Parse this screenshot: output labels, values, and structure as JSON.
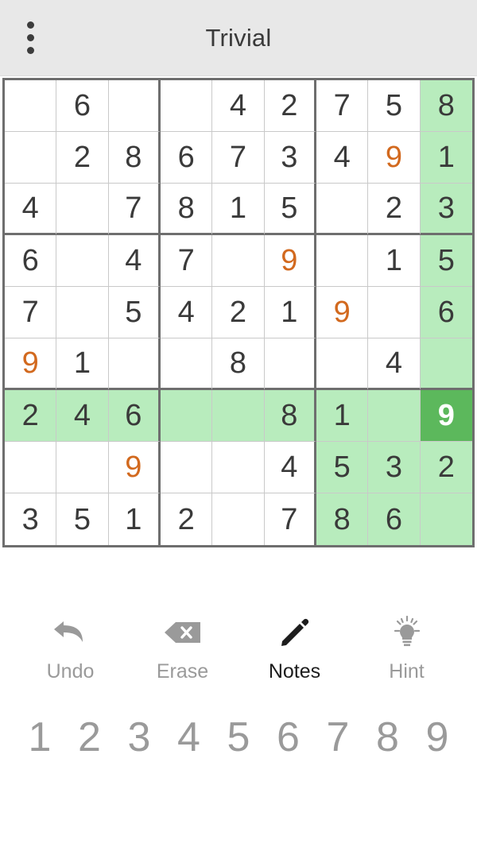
{
  "header": {
    "title": "Trivial",
    "menu_icon": "overflow-menu-icon"
  },
  "board": {
    "selected": {
      "row": 6,
      "col": 8
    },
    "colors": {
      "highlight": "#b8ecbd",
      "selected": "#5cb85c",
      "given_text": "#3a3a3a",
      "user_text": "#d2691e",
      "selected_text": "#ffffff",
      "grid_line": "#c9c9c9",
      "box_line": "#6e6e6e"
    },
    "rows": [
      [
        {
          "v": "",
          "t": "given",
          "h": false
        },
        {
          "v": "6",
          "t": "given",
          "h": false
        },
        {
          "v": "",
          "t": "given",
          "h": false
        },
        {
          "v": "",
          "t": "given",
          "h": false
        },
        {
          "v": "4",
          "t": "given",
          "h": false
        },
        {
          "v": "2",
          "t": "given",
          "h": false
        },
        {
          "v": "7",
          "t": "given",
          "h": false
        },
        {
          "v": "5",
          "t": "given",
          "h": false
        },
        {
          "v": "8",
          "t": "given",
          "h": true
        }
      ],
      [
        {
          "v": "",
          "t": "given",
          "h": false
        },
        {
          "v": "2",
          "t": "given",
          "h": false
        },
        {
          "v": "8",
          "t": "given",
          "h": false
        },
        {
          "v": "6",
          "t": "given",
          "h": false
        },
        {
          "v": "7",
          "t": "given",
          "h": false
        },
        {
          "v": "3",
          "t": "given",
          "h": false
        },
        {
          "v": "4",
          "t": "given",
          "h": false
        },
        {
          "v": "9",
          "t": "user",
          "h": false
        },
        {
          "v": "1",
          "t": "given",
          "h": true
        }
      ],
      [
        {
          "v": "4",
          "t": "given",
          "h": false
        },
        {
          "v": "",
          "t": "given",
          "h": false
        },
        {
          "v": "7",
          "t": "given",
          "h": false
        },
        {
          "v": "8",
          "t": "given",
          "h": false
        },
        {
          "v": "1",
          "t": "given",
          "h": false
        },
        {
          "v": "5",
          "t": "given",
          "h": false
        },
        {
          "v": "",
          "t": "given",
          "h": false
        },
        {
          "v": "2",
          "t": "given",
          "h": false
        },
        {
          "v": "3",
          "t": "given",
          "h": true
        }
      ],
      [
        {
          "v": "6",
          "t": "given",
          "h": false
        },
        {
          "v": "",
          "t": "given",
          "h": false
        },
        {
          "v": "4",
          "t": "given",
          "h": false
        },
        {
          "v": "7",
          "t": "given",
          "h": false
        },
        {
          "v": "",
          "t": "given",
          "h": false
        },
        {
          "v": "9",
          "t": "user",
          "h": false
        },
        {
          "v": "",
          "t": "given",
          "h": false
        },
        {
          "v": "1",
          "t": "given",
          "h": false
        },
        {
          "v": "5",
          "t": "given",
          "h": true
        }
      ],
      [
        {
          "v": "7",
          "t": "given",
          "h": false
        },
        {
          "v": "",
          "t": "given",
          "h": false
        },
        {
          "v": "5",
          "t": "given",
          "h": false
        },
        {
          "v": "4",
          "t": "given",
          "h": false
        },
        {
          "v": "2",
          "t": "given",
          "h": false
        },
        {
          "v": "1",
          "t": "given",
          "h": false
        },
        {
          "v": "9",
          "t": "user",
          "h": false
        },
        {
          "v": "",
          "t": "given",
          "h": false
        },
        {
          "v": "6",
          "t": "given",
          "h": true
        }
      ],
      [
        {
          "v": "9",
          "t": "user",
          "h": false
        },
        {
          "v": "1",
          "t": "given",
          "h": false
        },
        {
          "v": "",
          "t": "given",
          "h": false
        },
        {
          "v": "",
          "t": "given",
          "h": false
        },
        {
          "v": "8",
          "t": "given",
          "h": false
        },
        {
          "v": "",
          "t": "given",
          "h": false
        },
        {
          "v": "",
          "t": "given",
          "h": false
        },
        {
          "v": "4",
          "t": "given",
          "h": false
        },
        {
          "v": "",
          "t": "given",
          "h": true
        }
      ],
      [
        {
          "v": "2",
          "t": "given",
          "h": true
        },
        {
          "v": "4",
          "t": "given",
          "h": true
        },
        {
          "v": "6",
          "t": "given",
          "h": true
        },
        {
          "v": "",
          "t": "given",
          "h": true
        },
        {
          "v": "",
          "t": "given",
          "h": true
        },
        {
          "v": "8",
          "t": "given",
          "h": true
        },
        {
          "v": "1",
          "t": "given",
          "h": true
        },
        {
          "v": "",
          "t": "given",
          "h": true
        },
        {
          "v": "9",
          "t": "selected",
          "h": true
        }
      ],
      [
        {
          "v": "",
          "t": "given",
          "h": false
        },
        {
          "v": "",
          "t": "given",
          "h": false
        },
        {
          "v": "9",
          "t": "user",
          "h": false
        },
        {
          "v": "",
          "t": "given",
          "h": false
        },
        {
          "v": "",
          "t": "given",
          "h": false
        },
        {
          "v": "4",
          "t": "given",
          "h": false
        },
        {
          "v": "5",
          "t": "given",
          "h": true
        },
        {
          "v": "3",
          "t": "given",
          "h": true
        },
        {
          "v": "2",
          "t": "given",
          "h": true
        }
      ],
      [
        {
          "v": "3",
          "t": "given",
          "h": false
        },
        {
          "v": "5",
          "t": "given",
          "h": false
        },
        {
          "v": "1",
          "t": "given",
          "h": false
        },
        {
          "v": "2",
          "t": "given",
          "h": false
        },
        {
          "v": "",
          "t": "given",
          "h": false
        },
        {
          "v": "7",
          "t": "given",
          "h": false
        },
        {
          "v": "8",
          "t": "given",
          "h": true
        },
        {
          "v": "6",
          "t": "given",
          "h": true
        },
        {
          "v": "",
          "t": "given",
          "h": true
        }
      ]
    ]
  },
  "tools": [
    {
      "label": "Undo",
      "icon": "undo-arrow-icon",
      "active": false
    },
    {
      "label": "Erase",
      "icon": "erase-backspace-icon",
      "active": false
    },
    {
      "label": "Notes",
      "icon": "pencil-icon",
      "active": true
    },
    {
      "label": "Hint",
      "icon": "lightbulb-icon",
      "active": false
    }
  ],
  "numpad": [
    "1",
    "2",
    "3",
    "4",
    "5",
    "6",
    "7",
    "8",
    "9"
  ]
}
